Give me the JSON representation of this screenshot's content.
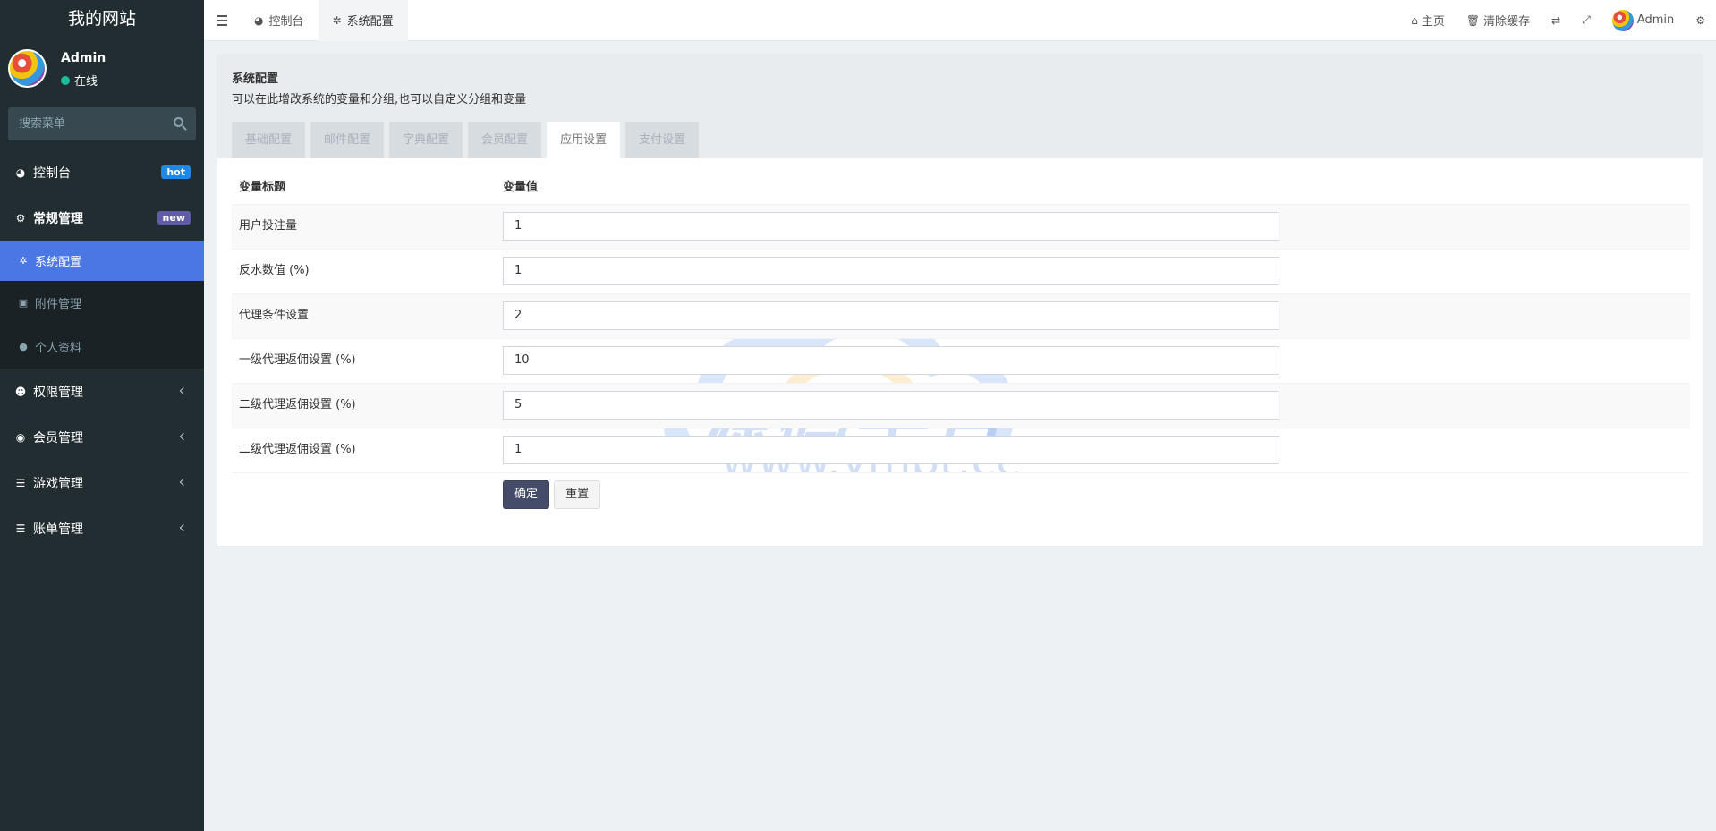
{
  "sidebar": {
    "site_title": "我的网站",
    "user": {
      "name": "Admin",
      "status": "在线"
    },
    "search_placeholder": "搜索菜单",
    "items": [
      {
        "label": "控制台",
        "badge": "hot"
      },
      {
        "label": "常规管理",
        "badge": "new"
      },
      {
        "label": "系统配置"
      },
      {
        "label": "附件管理"
      },
      {
        "label": "个人资料"
      },
      {
        "label": "权限管理"
      },
      {
        "label": "会员管理"
      },
      {
        "label": "游戏管理"
      },
      {
        "label": "账单管理"
      }
    ]
  },
  "topbar": {
    "tabs": [
      {
        "label": "控制台"
      },
      {
        "label": "系统配置"
      }
    ],
    "home_label": "主页",
    "clear_cache_label": "清除缓存",
    "user_label": "Admin"
  },
  "panel": {
    "title": "系统配置",
    "description": "可以在此增改系统的变量和分组,也可以自定义分组和变量",
    "tabs": [
      "基础配置",
      "邮件配置",
      "字典配置",
      "会员配置",
      "应用设置",
      "支付设置"
    ],
    "active_tab": "应用设置",
    "table": {
      "headers": [
        "变量标题",
        "变量值"
      ],
      "rows": [
        {
          "label": "用户投注量",
          "value": "1"
        },
        {
          "label": "反水数值 (%)",
          "value": "1"
        },
        {
          "label": "代理条件设置",
          "value": "2"
        },
        {
          "label": "一级代理返佣设置 (%)",
          "value": "10"
        },
        {
          "label": "二级代理返佣设置 (%)",
          "value": "5"
        },
        {
          "label": "二级代理返佣设置 (%)",
          "value": "1"
        }
      ]
    },
    "submit_label": "确定",
    "reset_label": "重置"
  },
  "watermark": {
    "text": "源码平台",
    "url": "www.ympt.cc"
  },
  "colors": {
    "sidebar_bg": "#222d32",
    "active_item": "#4b77e5",
    "primary_button": "#444c69",
    "badge_hot": "#1e88e5",
    "badge_new": "#605ca8"
  }
}
